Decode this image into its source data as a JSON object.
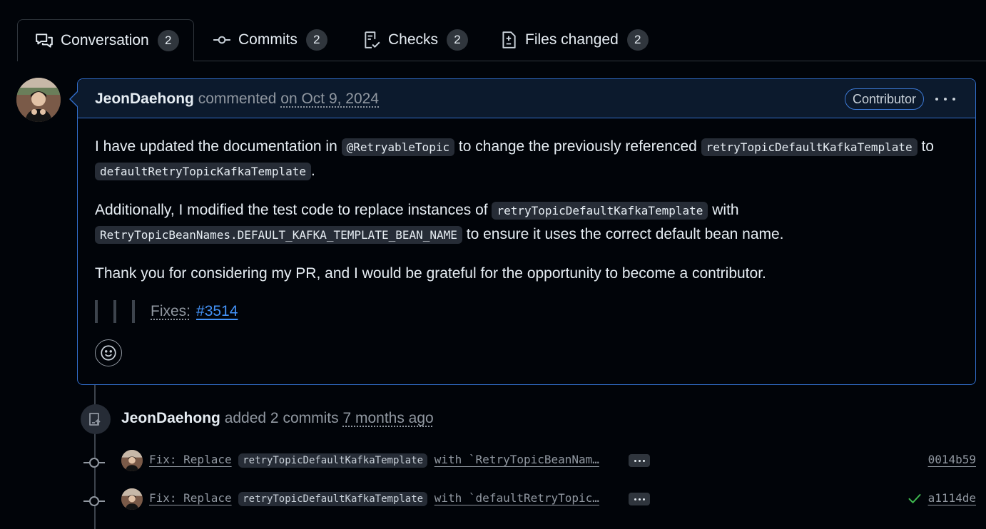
{
  "tabs": [
    {
      "label": "Conversation",
      "count": "2",
      "icon": "comment-discussion-icon"
    },
    {
      "label": "Commits",
      "count": "2",
      "icon": "git-commit-icon"
    },
    {
      "label": "Checks",
      "count": "2",
      "icon": "checklist-icon"
    },
    {
      "label": "Files changed",
      "count": "2",
      "icon": "file-diff-icon"
    }
  ],
  "comment": {
    "author": "JeonDaehong",
    "verb": "commented",
    "date": "on Oct 9, 2024",
    "badge": "Contributor",
    "p1": {
      "t1": "I have updated the documentation in ",
      "c1": "@RetryableTopic",
      "t2": " to change the previously referenced ",
      "c2": "retryTopicDefaultKafkaTemplate",
      "t3": " to ",
      "c3": "defaultRetryTopicKafkaTemplate",
      "t4": "."
    },
    "p2": {
      "t1": "Additionally, I modified the test code to replace instances of ",
      "c1": "retryTopicDefaultKafkaTemplate",
      "t2": " with ",
      "c2": "RetryTopicBeanNames.DEFAULT_KAFKA_TEMPLATE_BEAN_NAME",
      "t3": " to ensure it uses the correct default bean name."
    },
    "p3": "Thank you for considering my PR, and I would be grateful for the opportunity to become a contributor.",
    "quote_label": "Fixes:",
    "quote_link": "#3514"
  },
  "event": {
    "who": "JeonDaehong",
    "what": "added 2 commits",
    "when": "7 months ago"
  },
  "commits": [
    {
      "prefix": "Fix: Replace",
      "code": "retryTopicDefaultKafkaTemplate",
      "suffix": "with `RetryTopicBeanNam…",
      "sha": "0014b59",
      "status": ""
    },
    {
      "prefix": "Fix: Replace",
      "code": "retryTopicDefaultKafkaTemplate",
      "suffix": "with `defaultRetryTopic…",
      "sha": "a1114de",
      "status": "success"
    }
  ],
  "colors": {
    "accent": "#316dca",
    "link": "#4493f8",
    "success": "#3fb950"
  }
}
